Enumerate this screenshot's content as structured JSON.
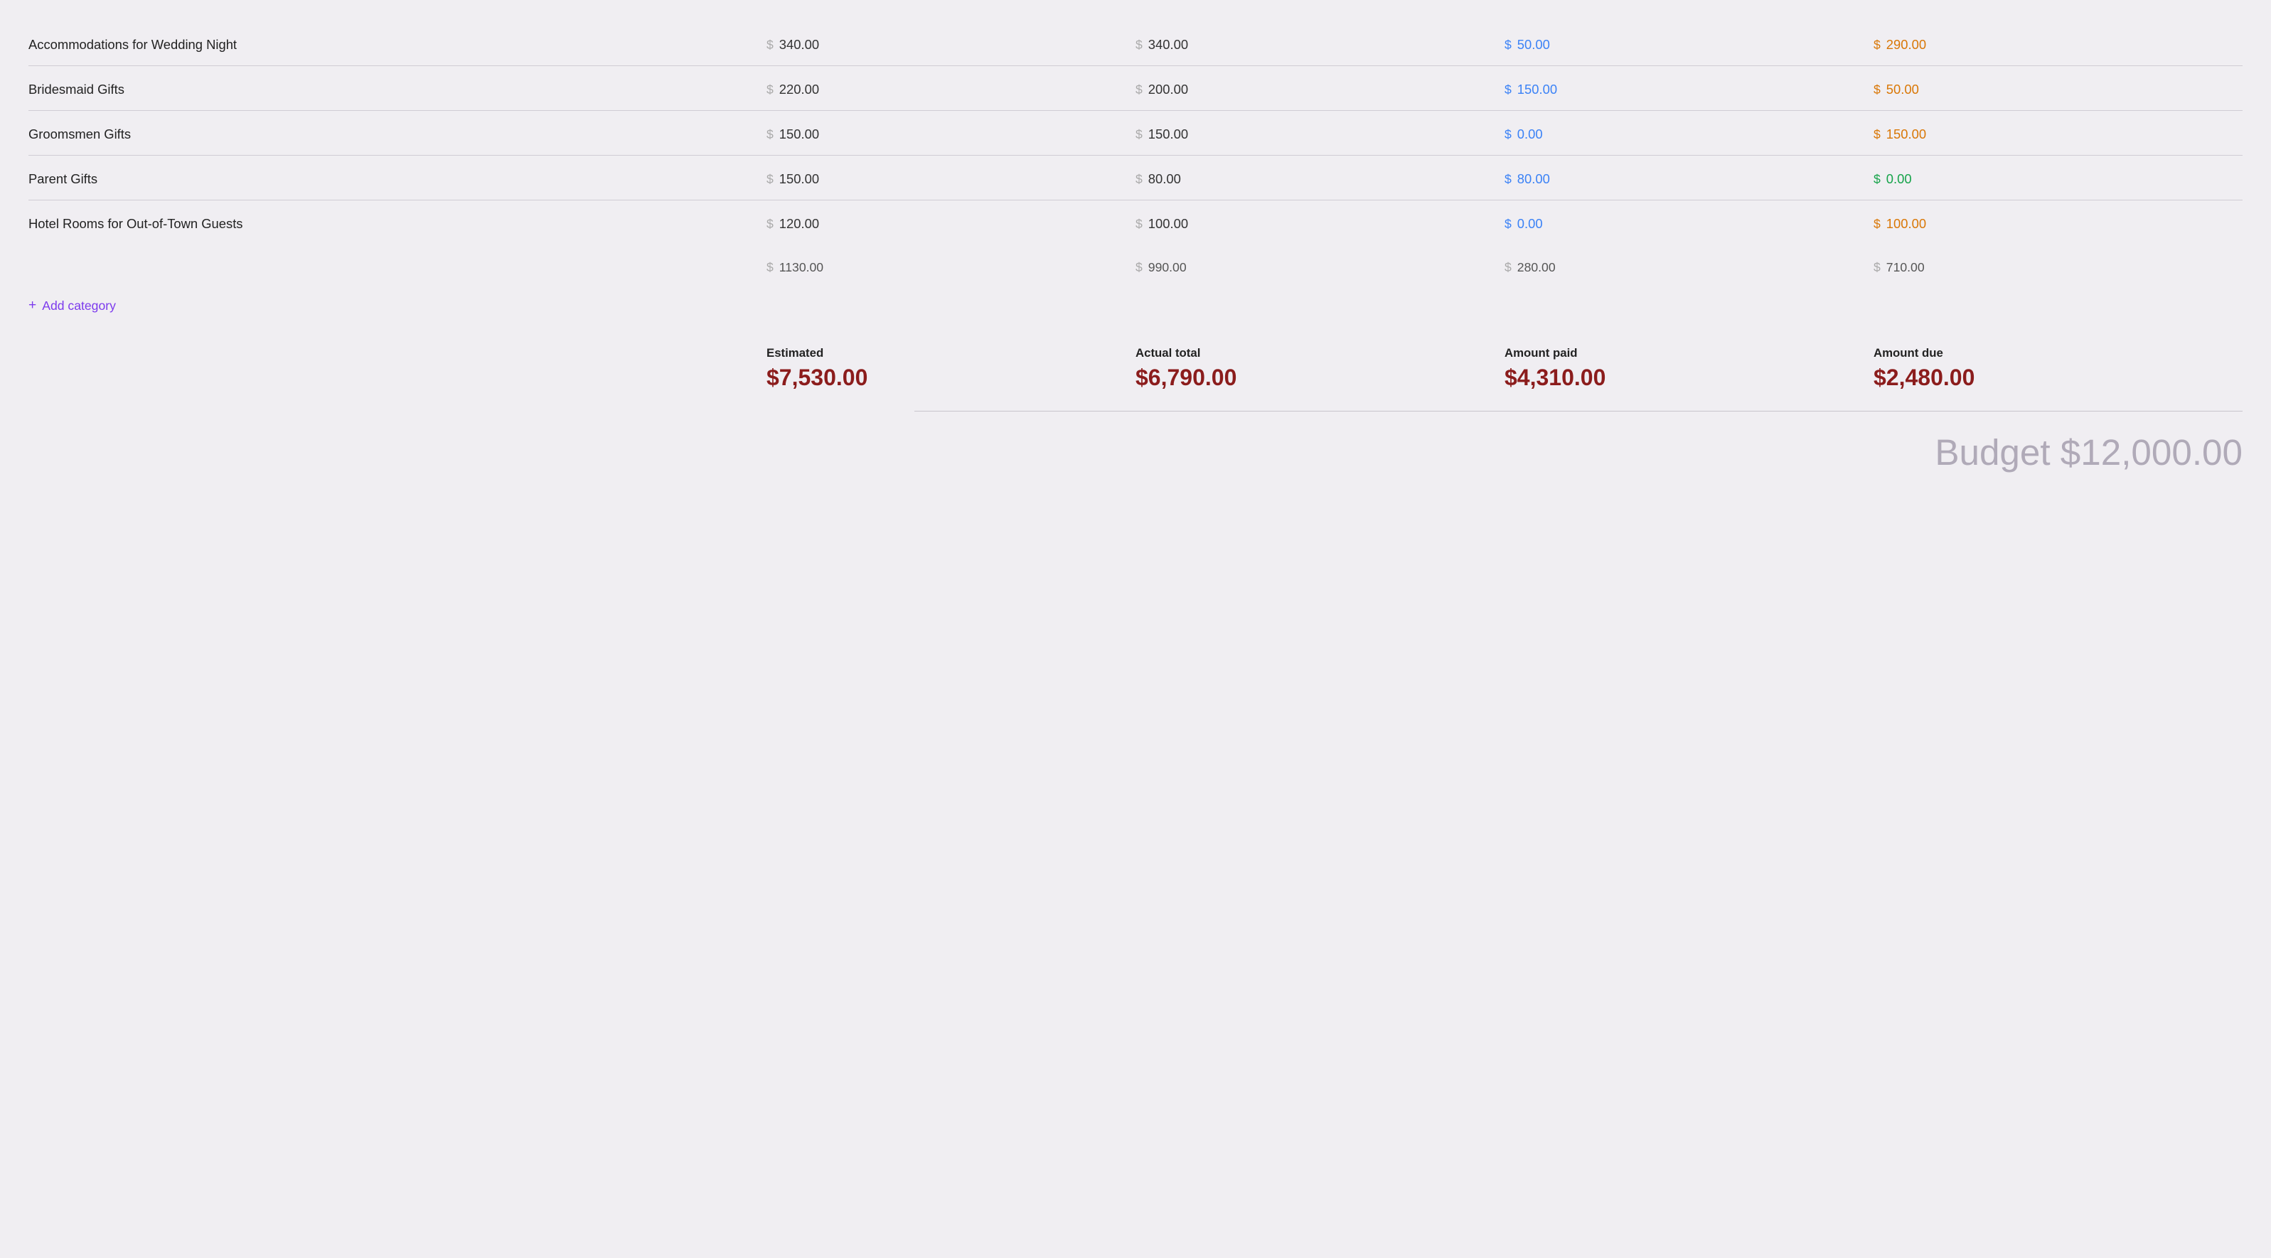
{
  "rows": [
    {
      "name": "Accommodations for Wedding Night",
      "estimated": "340.00",
      "actual": "340.00",
      "paid": "50.00",
      "due": "290.00",
      "due_color": "orange"
    },
    {
      "name": "Bridesmaid Gifts",
      "estimated": "220.00",
      "actual": "200.00",
      "paid": "150.00",
      "due": "50.00",
      "due_color": "orange"
    },
    {
      "name": "Groomsmen Gifts",
      "estimated": "150.00",
      "actual": "150.00",
      "paid": "0.00",
      "due": "150.00",
      "due_color": "orange"
    },
    {
      "name": "Parent Gifts",
      "estimated": "150.00",
      "actual": "80.00",
      "paid": "80.00",
      "due": "0.00",
      "due_color": "green"
    },
    {
      "name": "Hotel Rooms for Out-of-Town Guests",
      "estimated": "120.00",
      "actual": "100.00",
      "paid": "0.00",
      "due": "100.00",
      "due_color": "orange"
    }
  ],
  "totals": {
    "estimated": "1130.00",
    "actual": "990.00",
    "paid": "280.00",
    "due": "710.00"
  },
  "add_category_label": "Add category",
  "summary": {
    "estimated_label": "Estimated",
    "estimated_value": "$7,530.00",
    "actual_label": "Actual total",
    "actual_value": "$6,790.00",
    "paid_label": "Amount paid",
    "paid_value": "$4,310.00",
    "due_label": "Amount due",
    "due_value": "$2,480.00"
  },
  "budget_label": "Budget $12,000.00",
  "dollar_sign": "$"
}
